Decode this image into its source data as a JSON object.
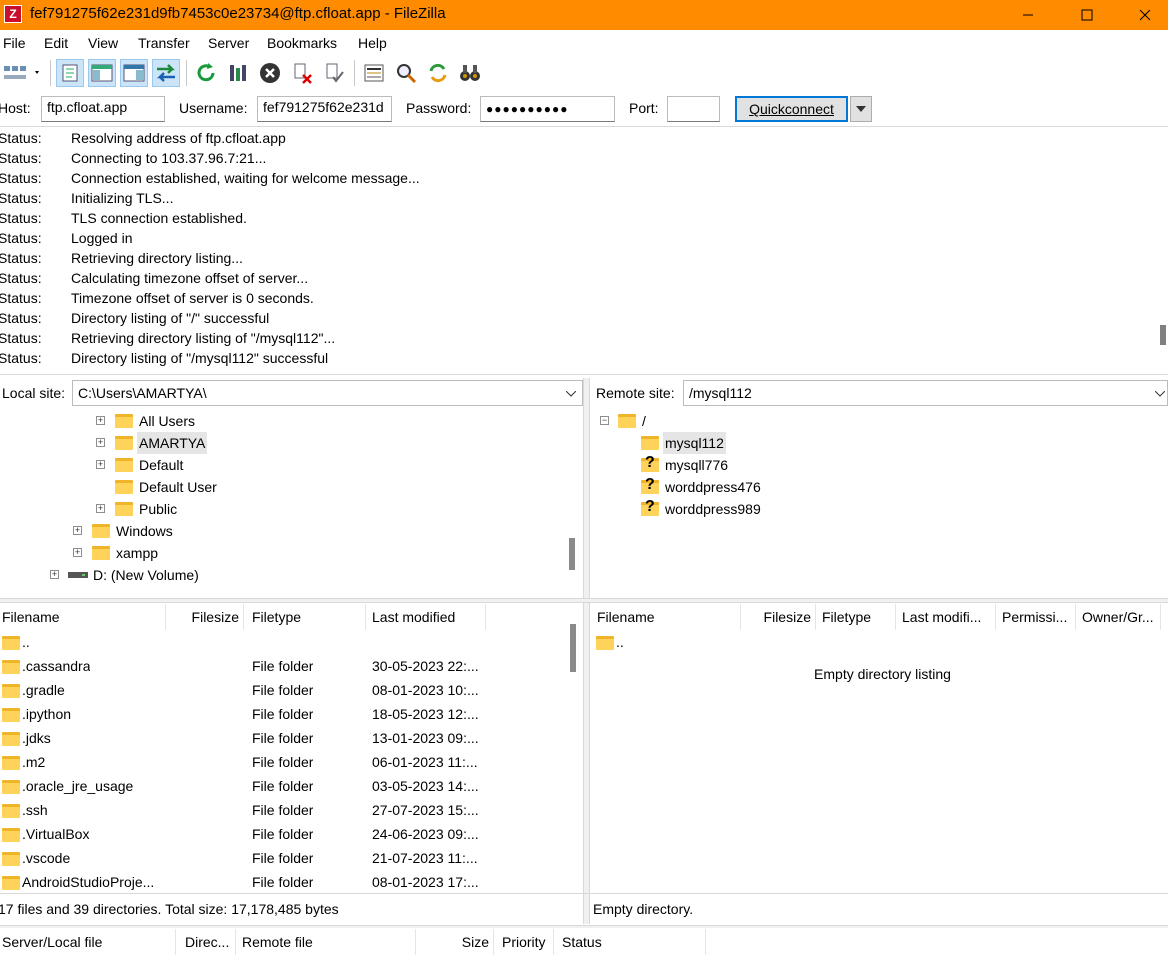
{
  "window": {
    "title": "fef791275f62e231d9fb7453c0e23734@ftp.cfloat.app - FileZilla",
    "app_icon": "Z"
  },
  "menu": [
    "File",
    "Edit",
    "View",
    "Transfer",
    "Server",
    "Bookmarks",
    "Help"
  ],
  "quickconnect": {
    "host_label": "Host:",
    "host": "ftp.cfloat.app",
    "username_label": "Username:",
    "username": "fef791275f62e231d",
    "password_label": "Password:",
    "password": "●●●●●●●●●●",
    "port_label": "Port:",
    "port": "",
    "button": "Quickconnect"
  },
  "log": [
    {
      "label": "Status:",
      "msg": "Resolving address of ftp.cfloat.app"
    },
    {
      "label": "Status:",
      "msg": "Connecting to 103.37.96.7:21..."
    },
    {
      "label": "Status:",
      "msg": "Connection established, waiting for welcome message..."
    },
    {
      "label": "Status:",
      "msg": "Initializing TLS..."
    },
    {
      "label": "Status:",
      "msg": "TLS connection established."
    },
    {
      "label": "Status:",
      "msg": "Logged in"
    },
    {
      "label": "Status:",
      "msg": "Retrieving directory listing..."
    },
    {
      "label": "Status:",
      "msg": "Calculating timezone offset of server..."
    },
    {
      "label": "Status:",
      "msg": "Timezone offset of server is 0 seconds."
    },
    {
      "label": "Status:",
      "msg": "Directory listing of \"/\" successful"
    },
    {
      "label": "Status:",
      "msg": "Retrieving directory listing of \"/mysql112\"..."
    },
    {
      "label": "Status:",
      "msg": "Directory listing of \"/mysql112\" successful"
    }
  ],
  "local": {
    "label": "Local site:",
    "path": "C:\\Users\\AMARTYA\\",
    "tree": [
      "All Users",
      "AMARTYA",
      "Default",
      "Default User",
      "Public",
      "Windows",
      "xampp",
      "D: (New Volume)"
    ],
    "columns": [
      "Filename",
      "Filesize",
      "Filetype",
      "Last modified"
    ],
    "files": [
      {
        "name": "..",
        "type": "",
        "date": ""
      },
      {
        "name": ".cassandra",
        "type": "File folder",
        "date": "30-05-2023 22:..."
      },
      {
        "name": ".gradle",
        "type": "File folder",
        "date": "08-01-2023 10:..."
      },
      {
        "name": ".ipython",
        "type": "File folder",
        "date": "18-05-2023 12:..."
      },
      {
        "name": ".jdks",
        "type": "File folder",
        "date": "13-01-2023 09:..."
      },
      {
        "name": ".m2",
        "type": "File folder",
        "date": "06-01-2023 11:..."
      },
      {
        "name": ".oracle_jre_usage",
        "type": "File folder",
        "date": "03-05-2023 14:..."
      },
      {
        "name": ".ssh",
        "type": "File folder",
        "date": "27-07-2023 15:..."
      },
      {
        "name": ".VirtualBox",
        "type": "File folder",
        "date": "24-06-2023 09:..."
      },
      {
        "name": ".vscode",
        "type": "File folder",
        "date": "21-07-2023 11:..."
      },
      {
        "name": "AndroidStudioProje...",
        "type": "File folder",
        "date": "08-01-2023 17:..."
      }
    ],
    "status": "17 files and 39 directories. Total size: 17,178,485 bytes"
  },
  "remote": {
    "label": "Remote site:",
    "path": "/mysql112",
    "tree_root": "/",
    "tree": [
      "mysql112",
      "mysqll776",
      "worddpress476",
      "worddpress989"
    ],
    "columns": [
      "Filename",
      "Filesize",
      "Filetype",
      "Last modifi...",
      "Permissi...",
      "Owner/Gr..."
    ],
    "files": [
      {
        "name": ".."
      }
    ],
    "empty": "Empty directory listing",
    "status": "Empty directory."
  },
  "queue": {
    "columns": [
      "Server/Local file",
      "Direc...",
      "Remote file",
      "Size",
      "Priority",
      "Status"
    ]
  }
}
